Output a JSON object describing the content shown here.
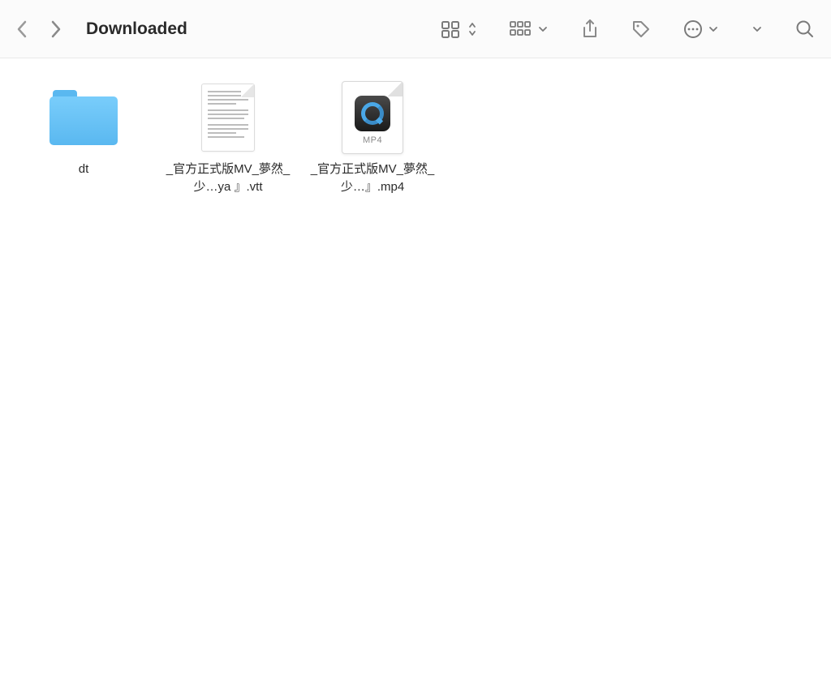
{
  "header": {
    "title": "Downloaded"
  },
  "items": [
    {
      "type": "folder",
      "name": "dt"
    },
    {
      "type": "text",
      "name": "_官方正式版MV_夢然_少…ya 』.vtt"
    },
    {
      "type": "mp4",
      "name": "_官方正式版MV_夢然_少…』.mp4",
      "badge": "MP4"
    }
  ]
}
